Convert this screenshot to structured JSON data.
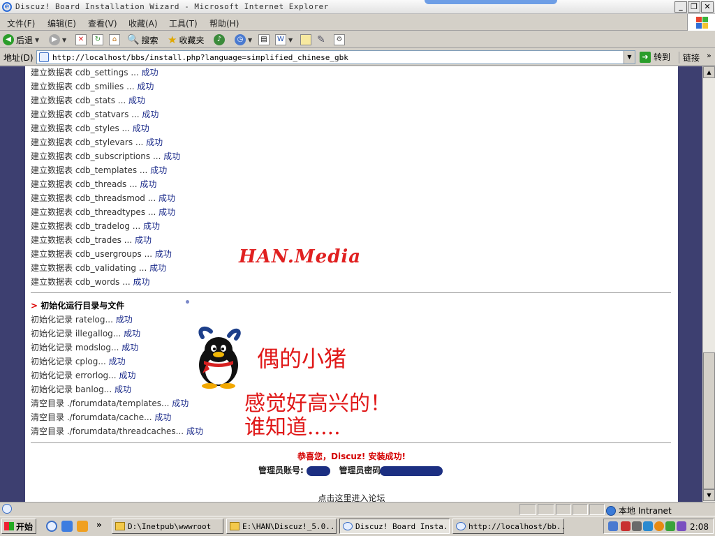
{
  "window": {
    "title": "Discuz! Board Installation Wizard - Microsoft Internet Explorer",
    "minimize": "_",
    "restore": "❐",
    "close": "✕"
  },
  "menu": [
    "文件(F)",
    "编辑(E)",
    "查看(V)",
    "收藏(A)",
    "工具(T)",
    "帮助(H)"
  ],
  "toolbar": {
    "back": "后退",
    "search": "搜索",
    "favorites": "收藏夹"
  },
  "address": {
    "label": "地址(D)",
    "url": "http://localhost/bbs/install.php?language=simplified_chinese_gbk",
    "go": "转到",
    "links": "链接"
  },
  "tables": {
    "prefix": "建立数据表",
    "names": [
      "cdb_settings",
      "cdb_smilies",
      "cdb_stats",
      "cdb_statvars",
      "cdb_styles",
      "cdb_stylevars",
      "cdb_subscriptions",
      "cdb_templates",
      "cdb_threads",
      "cdb_threadsmod",
      "cdb_threadtypes",
      "cdb_tradelog",
      "cdb_trades",
      "cdb_usergroups",
      "cdb_validating",
      "cdb_words"
    ],
    "ellipsis": " ... ",
    "ok": "成功"
  },
  "init": {
    "heading_marker": ">",
    "heading": "初始化运行目录与文件",
    "items": [
      {
        "text": "初始化记录 ratelog...",
        "ok": "成功"
      },
      {
        "text": "初始化记录 illegallog...",
        "ok": "成功"
      },
      {
        "text": "初始化记录 modslog...",
        "ok": "成功"
      },
      {
        "text": "初始化记录 cplog...",
        "ok": "成功"
      },
      {
        "text": "初始化记录 errorlog...",
        "ok": "成功"
      },
      {
        "text": "初始化记录 banlog...",
        "ok": "成功"
      },
      {
        "text": "清空目录 ./forumdata/templates...",
        "ok": "成功"
      },
      {
        "text": "清空目录 ./forumdata/cache...",
        "ok": "成功"
      },
      {
        "text": "清空目录 ./forumdata/threadcaches...",
        "ok": "成功"
      }
    ]
  },
  "result": {
    "congrats": "恭喜您，Discuz! 安装成功!",
    "admin_account_label": "管理员账号:",
    "admin_password_label": "管理员密码",
    "enter_forum": "点击这里进入论坛"
  },
  "overlay": {
    "watermark": "HAN.Media",
    "note1": "偶的小猪",
    "note2": "感觉好高兴的！",
    "note3": "谁知道....."
  },
  "status": {
    "zone": "本地 Intranet"
  },
  "taskbar": {
    "start": "开始",
    "more": "»",
    "tasks": [
      {
        "label": "D:\\Inetpub\\wwwroot",
        "active": false
      },
      {
        "label": "E:\\HAN\\Discuz!_5.0....",
        "active": false
      },
      {
        "label": "Discuz! Board Insta...",
        "active": true
      },
      {
        "label": "http://localhost/bb...",
        "active": false
      }
    ],
    "clock": "2:08"
  },
  "colors": {
    "page_bg": "#3d3f70",
    "success": "#1a2a8a",
    "congrats": "#d40000",
    "overlay_red": "#e01818"
  }
}
